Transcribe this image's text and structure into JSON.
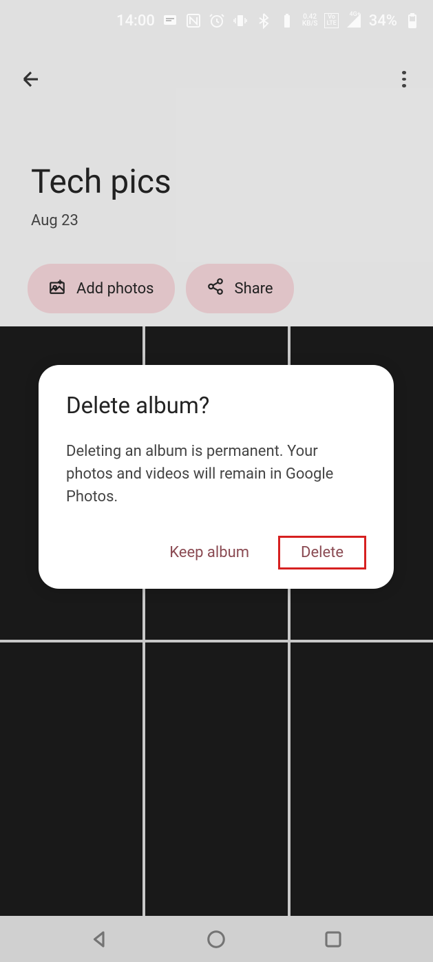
{
  "status_bar": {
    "time": "14:00",
    "data_rate": "0.42",
    "data_unit": "KB/S",
    "network_badge": "VoLTE",
    "network_type": "4G+",
    "battery_pct": "34%"
  },
  "album": {
    "title": "Tech pics",
    "date": "Aug 23"
  },
  "actions": {
    "add_photos": "Add photos",
    "share": "Share"
  },
  "dialog": {
    "title": "Delete album?",
    "message": "Deleting an album is permanent. Your photos and videos will remain in Google Photos.",
    "keep_label": "Keep album",
    "delete_label": "Delete"
  }
}
